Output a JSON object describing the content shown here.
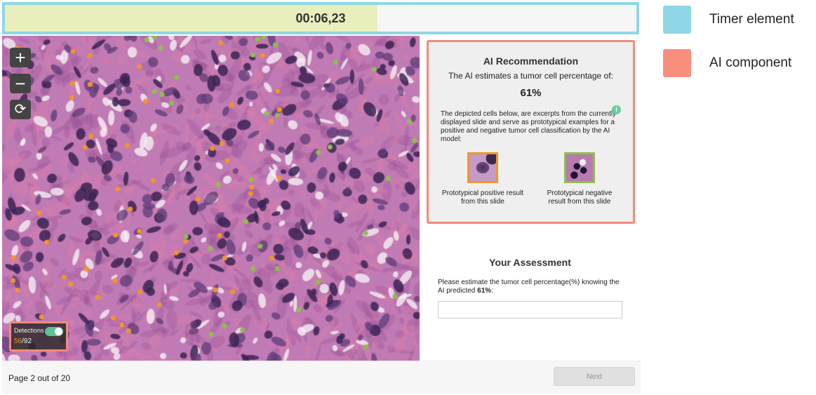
{
  "timer": {
    "text": "00:06,23",
    "progress_percent": 59,
    "fill_color": "#e8efbd",
    "border_color": "#8fd6e6"
  },
  "slide": {
    "controls": [
      {
        "icon": "plus-icon",
        "glyph": "+"
      },
      {
        "icon": "minus-icon",
        "glyph": "−"
      },
      {
        "icon": "rotate-icon",
        "glyph": "⟳"
      }
    ],
    "detections": {
      "label": "Detections",
      "enabled": true,
      "positive": "56",
      "total": "/92",
      "positive_color": "#f0962a",
      "negative_color": "#8dc04a"
    }
  },
  "ai": {
    "title": "AI Recommendation",
    "subtitle": "The AI estimates a tumor cell percentage of:",
    "percentage": "61%",
    "description": "The depicted cells below, are excerpts from the currently displayed slide and serve as prototypical examples for a positive and negative tumor cell classification by the AI model:",
    "info_icon": "i",
    "positive_label": "Prototypical positive result from this slide",
    "negative_label": "Prototypical negative result from this slide"
  },
  "assessment": {
    "title": "Your Assessment",
    "prompt": "Please estimate the tumor cell percentage(%) knowing the AI predicted ",
    "prompt_value": "61%",
    "prompt_end": ":",
    "input_value": ""
  },
  "footer": {
    "page": "Page 2 out of 20",
    "next_label": "Next"
  },
  "legend": [
    {
      "label": "Timer element",
      "color": "#8fd6e6"
    },
    {
      "label": "AI component",
      "color": "#f98e7f"
    }
  ]
}
